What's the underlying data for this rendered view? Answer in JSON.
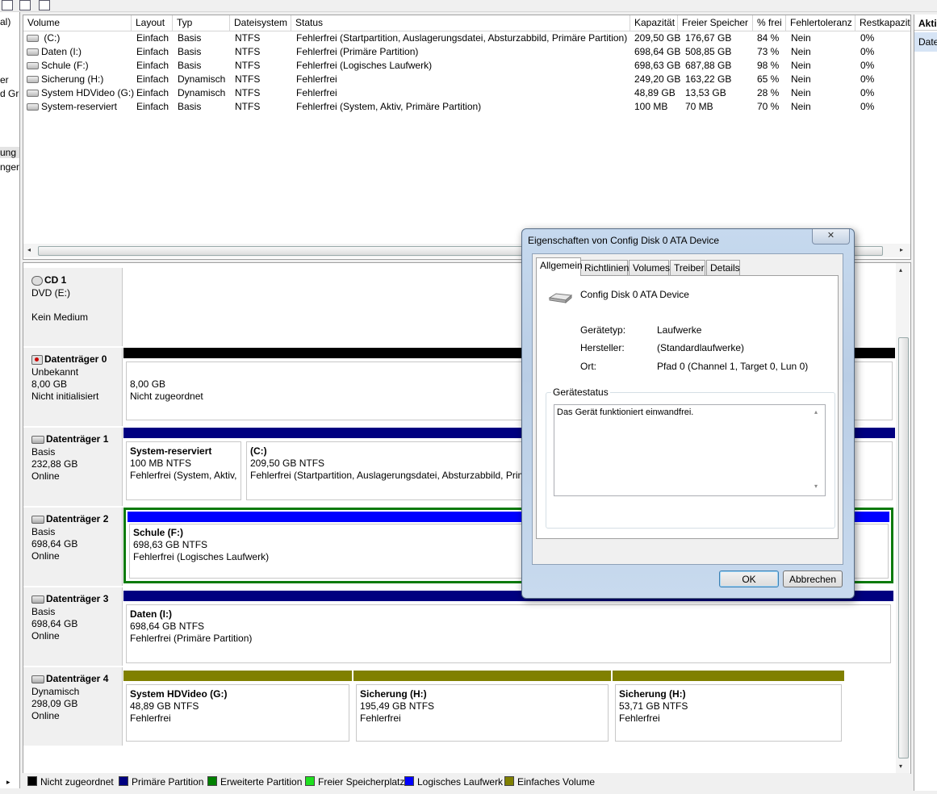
{
  "left_pane": {
    "items": [
      {
        "text": "al)"
      },
      {
        "text": "er"
      },
      {
        "text": "d Gr"
      },
      {
        "text": "ung"
      },
      {
        "text": "ngen"
      }
    ]
  },
  "volume_list": {
    "columns": [
      "Volume",
      "Layout",
      "Typ",
      "Dateisystem",
      "Status",
      "Kapazität",
      "Freier Speicher",
      "% frei",
      "Fehlertoleranz",
      "Restkapazit"
    ],
    "rows": [
      {
        "volume": " (C:)",
        "layout": "Einfach",
        "typ": "Basis",
        "fs": "NTFS",
        "status": "Fehlerfrei (Startpartition, Auslagerungsdatei, Absturzabbild, Primäre Partition)",
        "kap": "209,50 GB",
        "frei": "176,67 GB",
        "pct": "84 %",
        "ft": "Nein",
        "rest": "0%"
      },
      {
        "volume": "Daten (I:)",
        "layout": "Einfach",
        "typ": "Basis",
        "fs": "NTFS",
        "status": "Fehlerfrei (Primäre Partition)",
        "kap": "698,64 GB",
        "frei": "508,85 GB",
        "pct": "73 %",
        "ft": "Nein",
        "rest": "0%"
      },
      {
        "volume": "Schule (F:)",
        "layout": "Einfach",
        "typ": "Basis",
        "fs": "NTFS",
        "status": "Fehlerfrei (Logisches Laufwerk)",
        "kap": "698,63 GB",
        "frei": "687,88 GB",
        "pct": "98 %",
        "ft": "Nein",
        "rest": "0%"
      },
      {
        "volume": "Sicherung (H:)",
        "layout": "Einfach",
        "typ": "Dynamisch",
        "fs": "NTFS",
        "status": "Fehlerfrei",
        "kap": "249,20 GB",
        "frei": "163,22 GB",
        "pct": "65 %",
        "ft": "Nein",
        "rest": "0%"
      },
      {
        "volume": "System HDVideo (G:)",
        "layout": "Einfach",
        "typ": "Dynamisch",
        "fs": "NTFS",
        "status": "Fehlerfrei",
        "kap": "48,89 GB",
        "frei": "13,53 GB",
        "pct": "28 %",
        "ft": "Nein",
        "rest": "0%"
      },
      {
        "volume": "System-reserviert",
        "layout": "Einfach",
        "typ": "Basis",
        "fs": "NTFS",
        "status": "Fehlerfrei (System, Aktiv, Primäre Partition)",
        "kap": "100 MB",
        "frei": "70 MB",
        "pct": "70 %",
        "ft": "Nein",
        "rest": "0%"
      }
    ]
  },
  "disks": {
    "cd1": {
      "name": "CD 1",
      "line1": "DVD (E:)",
      "line2": "Kein Medium"
    },
    "disk0": {
      "name": "Datenträger 0",
      "line1": "Unbekannt",
      "line2": "8,00 GB",
      "line3": "Nicht initialisiert",
      "parts": [
        {
          "l1": "8,00 GB",
          "l2": "Nicht zugeordnet"
        }
      ]
    },
    "disk1": {
      "name": "Datenträger 1",
      "line1": "Basis",
      "line2": "232,88 GB",
      "line3": "Online",
      "parts": [
        {
          "l0": "System-reserviert",
          "l1": "100 MB NTFS",
          "l2": "Fehlerfrei (System, Aktiv,"
        },
        {
          "l0": " (C:)",
          "l1": "209,50 GB NTFS",
          "l2": "Fehlerfrei (Startpartition, Auslagerungsdatei, Absturzabbild, Prim"
        }
      ]
    },
    "disk2": {
      "name": "Datenträger 2",
      "line1": "Basis",
      "line2": "698,64 GB",
      "line3": "Online",
      "parts": [
        {
          "l0": "Schule  (F:)",
          "l1": "698,63 GB NTFS",
          "l2": "Fehlerfrei (Logisches Laufwerk)"
        }
      ]
    },
    "disk3": {
      "name": "Datenträger 3",
      "line1": "Basis",
      "line2": "698,64 GB",
      "line3": "Online",
      "parts": [
        {
          "l0": "Daten  (I:)",
          "l1": "698,64 GB NTFS",
          "l2": "Fehlerfrei (Primäre Partition)"
        }
      ]
    },
    "disk4": {
      "name": "Datenträger 4",
      "line1": "Dynamisch",
      "line2": "298,09 GB",
      "line3": "Online",
      "parts": [
        {
          "l0": "System HDVideo  (G:)",
          "l1": "48,89 GB NTFS",
          "l2": "Fehlerfrei"
        },
        {
          "l0": "Sicherung  (H:)",
          "l1": "195,49 GB NTFS",
          "l2": "Fehlerfrei"
        },
        {
          "l0": "Sicherung  (H:)",
          "l1": "53,71 GB NTFS",
          "l2": "Fehlerfrei"
        }
      ]
    }
  },
  "legend": [
    {
      "label": "Nicht zugeordnet",
      "color": "#000000"
    },
    {
      "label": "Primäre Partition",
      "color": "#000080"
    },
    {
      "label": "Erweiterte Partition",
      "color": "#008000"
    },
    {
      "label": "Freier Speicherplatz",
      "color": "#1fe01f"
    },
    {
      "label": "Logisches Laufwerk",
      "color": "#0000ff"
    },
    {
      "label": "Einfaches Volume",
      "color": "#808000"
    }
  ],
  "action_pane": {
    "header": "Akti",
    "item": "Date"
  },
  "dialog": {
    "title": "Eigenschaften von Config   Disk 0 ATA Device",
    "close_glyph": "✕",
    "tabs": [
      "Allgemein",
      "Richtlinien",
      "Volumes",
      "Treiber",
      "Details"
    ],
    "device_name": "Config   Disk 0 ATA Device",
    "props": [
      {
        "label": "Gerätetyp:",
        "value": "Laufwerke"
      },
      {
        "label": "Hersteller:",
        "value": "(Standardlaufwerke)"
      },
      {
        "label": "Ort:",
        "value": "Pfad 0 (Channel 1, Target 0, Lun 0)"
      }
    ],
    "status_group": "Gerätestatus",
    "status_text": "Das Gerät funktioniert einwandfrei.",
    "ok": "OK",
    "cancel": "Abbrechen"
  },
  "colors": {
    "primary": "#000080",
    "logical": "#0000ff",
    "simple": "#808000",
    "unallocated": "#000000",
    "extended": "#008000"
  }
}
